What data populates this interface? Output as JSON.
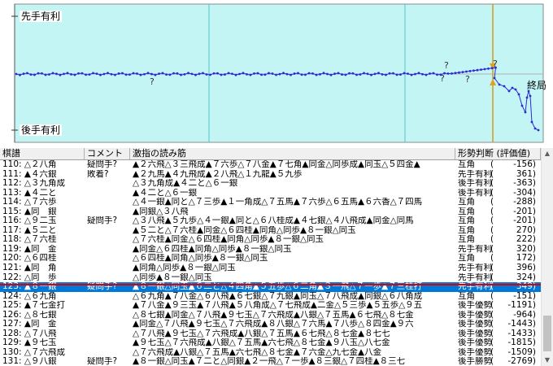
{
  "graph": {
    "top_label": "先手有利",
    "bottom_label": "後手有利",
    "end_label": "終局",
    "question_mark": "?",
    "colors": {
      "background": "#c4f5f5",
      "curve": "#2a2ad6",
      "cursor": "#d39a1c",
      "axis_line": "#55c4c4"
    }
  },
  "table": {
    "headers": [
      "棋譜",
      "コメント",
      "激指の読み筋",
      "形勢判断 (評価値)"
    ],
    "selected_index": 13,
    "rows": [
      {
        "move": "110: △２八角",
        "comment": "疑問手?",
        "pv": "▲２六飛△３三飛成▲７六歩△７八金▲７七角▲同金△同歩成▲同玉△５四金▲",
        "judge": "互角",
        "value": "-156)"
      },
      {
        "move": "111: ▲４六銀",
        "comment": "敗着?",
        "pv": "▲２九馬▲４九飛成▲２八飛△１九龍▲５九歩",
        "judge": "先手有利",
        "value": "361)"
      },
      {
        "move": "112: △３九角成",
        "comment": "",
        "pv": "△３九角成▲４二と△６一銀",
        "judge": "後手有利",
        "value": "-363)"
      },
      {
        "move": "113: ▲４二と",
        "comment": "",
        "pv": "▲４二と△６一銀",
        "judge": "後手有利",
        "value": "-304)"
      },
      {
        "move": "114: △７六歩",
        "comment": "",
        "pv": "△４一銀▲同と△７三歩▲１一角成△７五馬▲７六歩△６五馬▲６六香△７四馬",
        "judge": "互角",
        "value": "-288)"
      },
      {
        "move": "115: ▲同　銀",
        "comment": "",
        "pv": "▲同銀△３八飛",
        "judge": "互角",
        "value": "-201)"
      },
      {
        "move": "116: △９二玉",
        "comment": "疑問手?",
        "pv": "△３八飛▲５九歩△４一銀▲同と△６八桂成▲４七銀△４八飛成▲同金△同馬",
        "judge": "互角",
        "value": "-201)"
      },
      {
        "move": "117: ▲５二と",
        "comment": "",
        "pv": "▲５二と△７六桂▲同金△６四桂▲同角△同歩▲８一銀△同玉",
        "judge": "互角",
        "value": "270)"
      },
      {
        "move": "118: △７六桂",
        "comment": "",
        "pv": "△７六桂▲同金△６四桂▲同角△同歩▲８一銀△同玉",
        "judge": "互角",
        "value": "222)"
      },
      {
        "move": "119: ▲同　金",
        "comment": "",
        "pv": "▲同金△６四桂▲同角△同歩▲８一銀△同玉",
        "judge": "先手有利",
        "value": "320)"
      },
      {
        "move": "120: △６四桂",
        "comment": "",
        "pv": "△６四桂▲同角△同歩▲８一銀△同玉",
        "judge": "互角",
        "value": "172)"
      },
      {
        "move": "121: ▲同　角",
        "comment": "",
        "pv": "▲同角△同歩▲８一銀△同玉",
        "judge": "先手有利",
        "value": "396)"
      },
      {
        "move": "122: △同　歩",
        "comment": "",
        "pv": "△同歩▲８一銀△同玉",
        "judge": "先手有利",
        "value": "324)"
      },
      {
        "move": "123: ▲８一銀",
        "comment": "疑問手?",
        "pv": "▲８一銀△同玉▲６二と△４四角▲５五歩△６二角▲３一飛△７一歩▲７三桂打",
        "judge": "先手有利",
        "value": "349)"
      },
      {
        "move": "124: △６九角",
        "comment": "",
        "pv": "△６九角▲７八金△６八飛▲６七銀△７九銀▲同玉△７八飛成▲同銀△６八角成",
        "judge": "互角",
        "value": "-151)"
      },
      {
        "move": "125: ▲７七金打",
        "comment": "",
        "pv": "▲７八金▲９三玉▲７八飛▲５八角成△７七飛成▲二金△５三歩▲５五歩△９五",
        "judge": "後手優勢",
        "value": "-1191)"
      },
      {
        "move": "126: △８七銀",
        "comment": "",
        "pv": "△８七銀▲同金△７八飛▲９七玉△７六飛成▲八銀△７五馬▲６七飛△８七金",
        "judge": "後手優勢",
        "value": "-964)"
      },
      {
        "move": "127: ▲同　金",
        "comment": "",
        "pv": "▲同金△７八飛▲９七玉△７六飛成▲８八銀△７六馬▲７八歩△８四金▲９六",
        "judge": "後手優勢",
        "value": "-1443)"
      },
      {
        "move": "128: △７八飛",
        "comment": "",
        "pv": "△７八飛▲９七玉△７六飛成▲八銀△７五馬▲６七飛△８七金▲８七七",
        "judge": "後手優勢",
        "value": "-1433)"
      },
      {
        "move": "129: ▲９七玉",
        "comment": "",
        "pv": "▲９七玉△７六飛成▲八銀△７五馬▲六七飛△８七金▲９八玉△八七金",
        "judge": "後手優勢",
        "value": "-1815)"
      },
      {
        "move": "130: △７六飛成",
        "comment": "",
        "pv": "△７六飛成▲八銀△７五馬▲六七飛△８七金▲７六金△九七金▲八金",
        "judge": "後手優勢",
        "value": "-1509)"
      },
      {
        "move": "131: △９八銀",
        "comment": "疑問手?",
        "pv": "▲８一銀△同玉▲７二と△同銀▲２一飛△７一歩▲８三銀△７四桂▲８三七",
        "judge": "後手勝勢",
        "value": "-2769)"
      }
    ]
  }
}
